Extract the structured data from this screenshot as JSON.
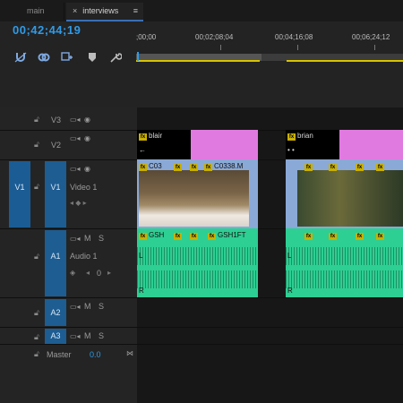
{
  "tabs": [
    {
      "label": "main"
    },
    {
      "label": "interviews",
      "close": "×",
      "menu": "≡"
    }
  ],
  "timecode": "00;42;44;19",
  "tools": [
    "snap-icon",
    "linked-selection-icon",
    "add-marker-icon",
    "marker-icon",
    "wrench-icon"
  ],
  "ruler": {
    "labels": [
      ";00;00",
      "00;02;08;04",
      "00;04;16;08",
      "00;06;24;12"
    ]
  },
  "tracks": {
    "v3": {
      "name": "V3"
    },
    "v2": {
      "name": "V2"
    },
    "v1": {
      "source": "V1",
      "name": "V1",
      "title": "Video 1"
    },
    "a1": {
      "name": "A1",
      "title": "Audio 1",
      "m": "M",
      "s": "S",
      "vol": "0"
    },
    "a2": {
      "name": "A2",
      "m": "M",
      "s": "S"
    },
    "a3": {
      "name": "A3",
      "m": "M",
      "s": "S"
    },
    "master": {
      "name": "Master",
      "value": "0.0"
    }
  },
  "clips": {
    "title1": {
      "name": "blair",
      "sub": "←"
    },
    "title2": {
      "name": "brian",
      "sub": "• •"
    },
    "video": {
      "c1": "C03",
      "c2": "C0338.M"
    },
    "audio": {
      "a1": "GSH",
      "a2": "GSH1FT",
      "ch_l": "L",
      "ch_r": "R"
    }
  },
  "fx_label": "fx",
  "colors": {
    "accent": "#2f9be8",
    "title_clip": "#e07ae0",
    "audio_clip": "#2dcf93",
    "video_clip": "#8aa9d6"
  }
}
